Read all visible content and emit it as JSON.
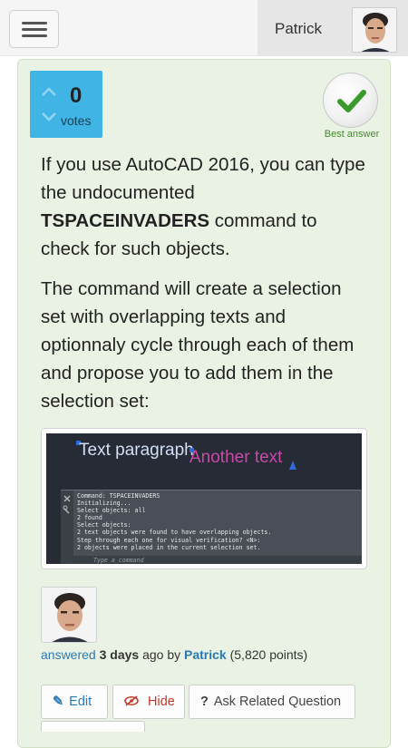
{
  "header": {
    "user_name": "Patrick",
    "menu_icon": "hamburger-icon",
    "avatar_icon": "user-avatar-icon"
  },
  "answer": {
    "votes": {
      "count": "0",
      "label": "votes"
    },
    "best_answer_label": "Best answer",
    "para1_prefix": "If you use AutoCAD 2016, you can type the undocumented ",
    "para1_bold": "TSPACEINVADERS",
    "para1_suffix": " command to check for such objects.",
    "para2": "The command will create a selection set with overlapping texts and optionnaly cycle through each of them and propose you to add them in the selection set:",
    "screenshot": {
      "text1": "Text paragraph",
      "text2": "Another text",
      "console_lines": [
        "Command: TSPACEINVADERS",
        "Initializing...",
        "Select objects: all",
        "2 found",
        "Select objects:",
        "2 text objects were found to have overlapping objects.",
        "Step through each one for visual verification? <N>:",
        "2 objects were placed in the current selection set."
      ],
      "console_placeholder": "Type a command"
    },
    "meta": {
      "answered": "answered",
      "time": "3 days",
      "ago_by": "ago by",
      "author": "Patrick",
      "points": "(5,820 points)"
    },
    "buttons": {
      "edit": "Edit",
      "hide": "Hide",
      "ask": "Ask Related Question"
    }
  },
  "colors": {
    "vote_bg": "#41b4e6",
    "card_bg": "#eaf3e3",
    "link": "#2a7ab8",
    "best_answer": "#3d8e2c"
  }
}
